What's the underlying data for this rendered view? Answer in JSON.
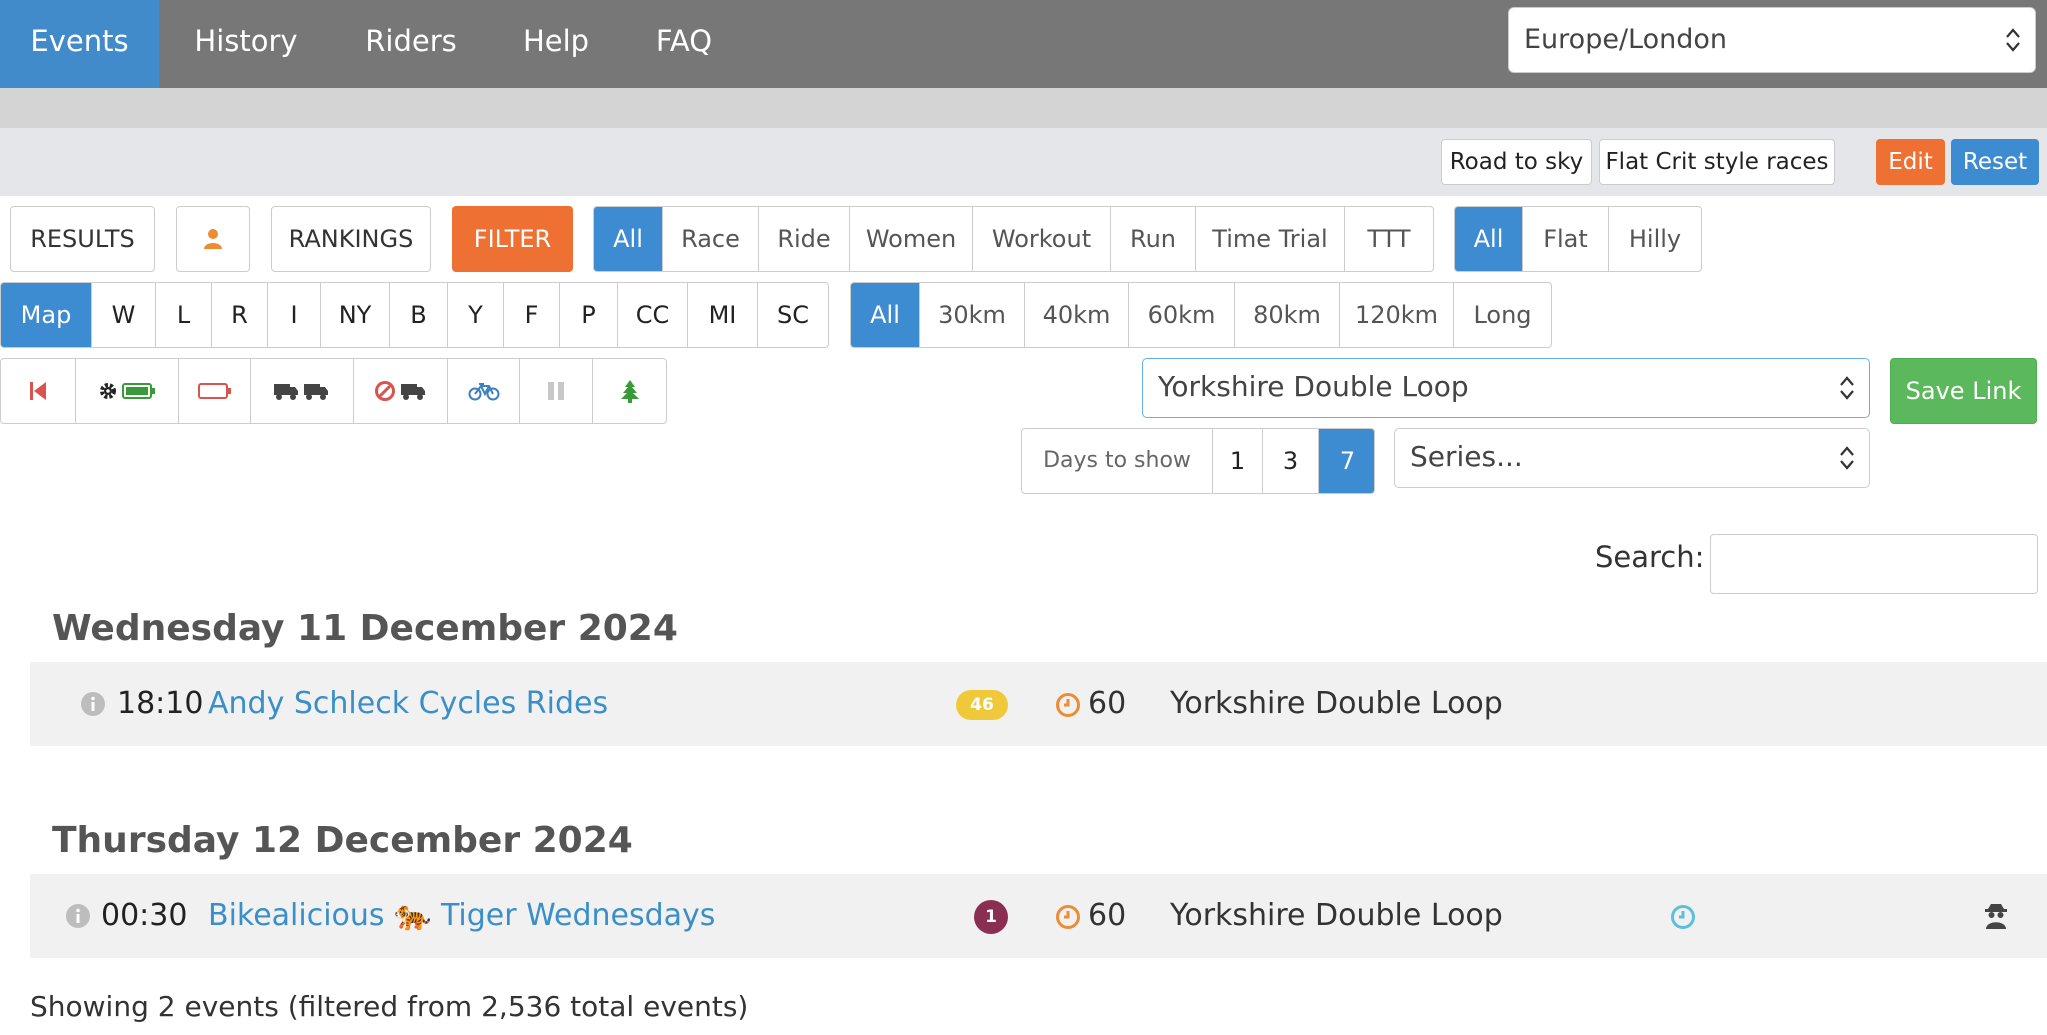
{
  "nav": {
    "tabs": [
      {
        "label": "Events",
        "active": true
      },
      {
        "label": "History"
      },
      {
        "label": "Riders"
      },
      {
        "label": "Help"
      },
      {
        "label": "FAQ"
      }
    ],
    "timezone": "Europe/London"
  },
  "presets": {
    "items": [
      "Road to sky",
      "Flat Crit style races"
    ],
    "edit_label": "Edit",
    "reset_label": "Reset"
  },
  "filters": {
    "results_label": "RESULTS",
    "rankings_label": "RANKINGS",
    "filter_label": "FILTER",
    "types": [
      "All",
      "Race",
      "Ride",
      "Women",
      "Workout",
      "Run",
      "Time Trial",
      "TTT"
    ],
    "terrain": [
      "All",
      "Flat",
      "Hilly"
    ],
    "maps": [
      "Map",
      "W",
      "L",
      "R",
      "I",
      "NY",
      "B",
      "Y",
      "F",
      "P",
      "CC",
      "MI",
      "SC"
    ],
    "distances": [
      "All",
      "30km",
      "40km",
      "60km",
      "80km",
      "120km",
      "Long"
    ],
    "route_selected": "Yorkshire Double Loop",
    "save_link_label": "Save Link",
    "days_to_show_label": "Days to show",
    "days_options": [
      "1",
      "3",
      "7"
    ],
    "days_selected": "7",
    "series_placeholder": "Series..."
  },
  "search": {
    "label": "Search:",
    "value": ""
  },
  "days": [
    {
      "heading": "Wednesday 11 December 2024",
      "events": [
        {
          "time": "18:10",
          "name": "Andy Schleck Cycles Rides",
          "badge": "46",
          "badge_color": "#f0c93a",
          "duration": "60",
          "route": "Yorkshire Double Loop"
        }
      ]
    },
    {
      "heading": "Thursday 12 December 2024",
      "events": [
        {
          "time": "00:30",
          "name": "Bikealicious 🐅 Tiger Wednesdays",
          "badge": "1",
          "badge_color": "#8b2f52",
          "duration": "60",
          "route": "Yorkshire Double Loop"
        }
      ]
    }
  ],
  "footer": {
    "summary": "Showing 2 events (filtered from 2,536 total events)"
  },
  "colors": {
    "primary": "#3d8bd0",
    "orange": "#ee7133",
    "green": "#5cb85c",
    "nav": "#777777"
  }
}
